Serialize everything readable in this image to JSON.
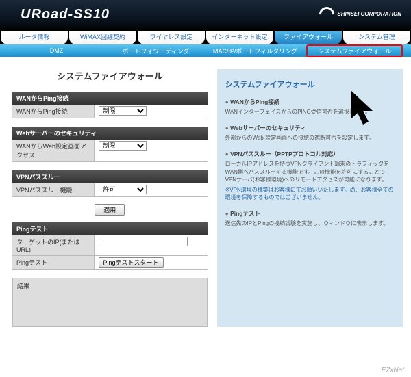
{
  "header": {
    "product": "URoad-SS10",
    "corp": "SHINSEI CORPORATION"
  },
  "maintabs": [
    "ルータ情報",
    "WiMAX回線契約",
    "ワイヤレス設定",
    "インターネット設定",
    "ファイアウォール",
    "システム管理"
  ],
  "maintabs_active": 4,
  "subtabs": [
    "DMZ",
    "ポートフォワーディング",
    "MAC/IP/ポートフィルタリング",
    "システムファイアウォール"
  ],
  "subtabs_active": 3,
  "page_title": "システムファイアウォール",
  "sections": {
    "wan_ping": {
      "title": "WANからPing接続",
      "label": "WANからPing接続",
      "value": "制限"
    },
    "web_sec": {
      "title": "Webサーバーのセキュリティ",
      "label": "WANからWeb設定画面アクセス",
      "value": "制限"
    },
    "vpn": {
      "title": "VPNパススルー",
      "label": "VPNパススルー機能",
      "value": "許可"
    }
  },
  "apply_btn": "適用",
  "ping_test": {
    "title": "Pingテスト",
    "target_label": "ターゲットのIP(またはURL)",
    "target_value": "",
    "action_label": "Pingテスト",
    "action_btn": "Pingテストスタート",
    "result_label": "結果"
  },
  "side": {
    "title": "システムファイアウォール",
    "items": [
      {
        "h": "WANからPing接続",
        "d": "WANインターフェイスからのPING受信可否を選択します。"
      },
      {
        "h": "Webサーバーのセキュリティ",
        "d": "外部からのWeb 設定画面への接続の遮断可否を設定します。"
      },
      {
        "h": "VPNパススルー（PPTPプロトコル対応）",
        "d": "ローカルIPアドレスを持つVPNクライアント端末のトラフィックをWAN側へパススルーする機能です。この機能を許可にすることでVPNサーバ(お客様環境)へのリモートアクセスが可能になります。",
        "note": "※VPN環境の構築はお客様にてお願いいたします。尚、お客様全ての環境を保障するものではございません。"
      },
      {
        "h": "Pingテスト",
        "d": "送信先のIPとPingの接続試験を実施し、ウィンドウに表示します。"
      }
    ]
  },
  "footer": "EZxNet"
}
